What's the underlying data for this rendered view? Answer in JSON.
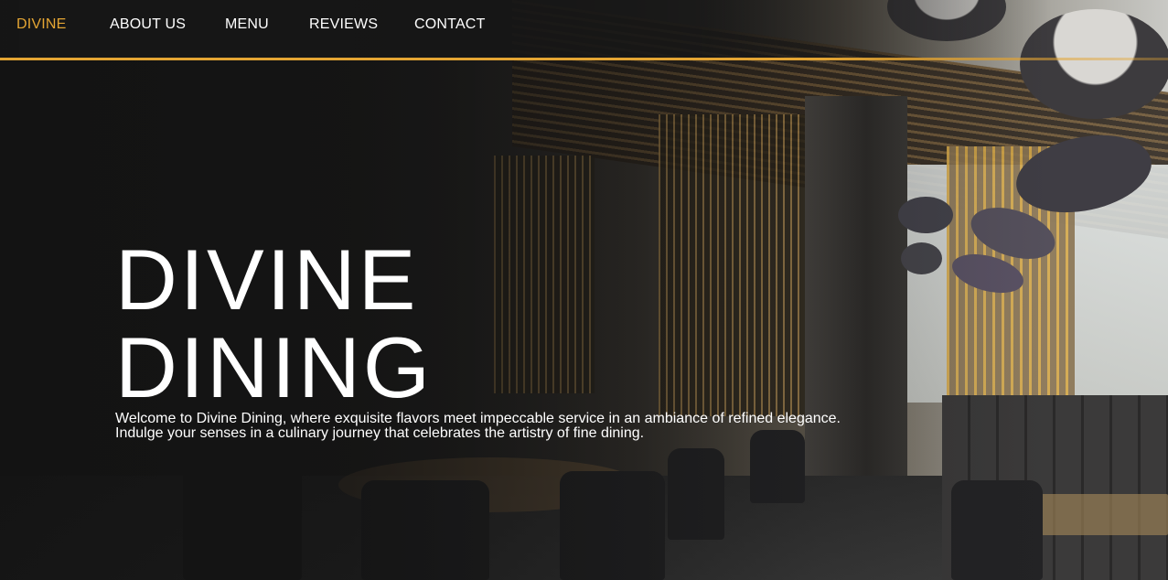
{
  "nav": {
    "brand": "DIVINE",
    "items": [
      {
        "label": "ABOUT US"
      },
      {
        "label": "MENU"
      },
      {
        "label": "REVIEWS"
      },
      {
        "label": "CONTACT"
      }
    ]
  },
  "hero": {
    "title_line1": "DIVINE",
    "title_line2": "DINING",
    "description_line1": "Welcome to Divine Dining, where exquisite flavors meet impeccable service in an ambiance of refined elegance.",
    "description_line2": "Indulge your senses in a culinary journey that celebrates the artistry of fine dining."
  },
  "colors": {
    "accent": "#e4a533",
    "text": "#ffffff",
    "background": "#1a1a1a"
  }
}
